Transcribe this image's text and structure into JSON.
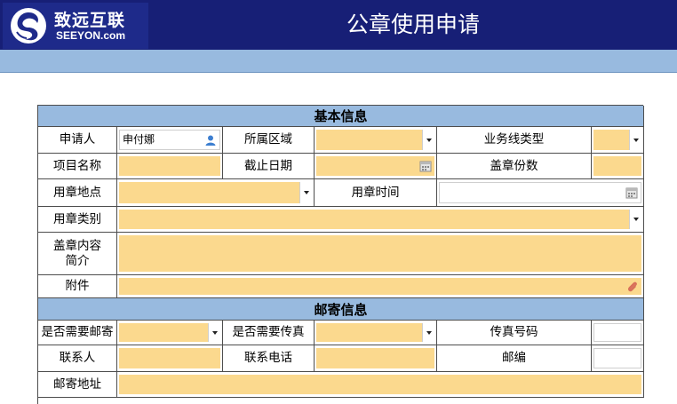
{
  "brand": {
    "name_cn": "致远互联",
    "name_en": "SEEYON.com"
  },
  "page_title": "公章使用申请",
  "sections": {
    "basic": "基本信息",
    "mail": "邮寄信息"
  },
  "labels": {
    "applicant": "申请人",
    "region": "所属区域",
    "business_line_type": "业务线类型",
    "project_name": "项目名称",
    "deadline": "截止日期",
    "seal_copies": "盖章份数",
    "seal_location": "用章地点",
    "seal_time": "用章时间",
    "seal_category": "用章类别",
    "content_line1": "盖章内容",
    "content_line2": "简介",
    "attachment": "附件",
    "need_mail": "是否需要邮寄",
    "need_fax": "是否需要传真",
    "fax_number": "传真号码",
    "contact": "联系人",
    "contact_phone": "联系电话",
    "postcode": "邮编",
    "mail_address": "邮寄地址"
  },
  "values": {
    "applicant": "申付娜"
  },
  "icons": {
    "logo": "seeyon-logo-icon",
    "person": "person-icon",
    "calendar": "calendar-icon",
    "dropdown": "chevron-down-icon",
    "attach": "paperclip-icon"
  },
  "colors": {
    "header_bg": "#171f76",
    "section_bg": "#98badf",
    "field_bg": "#fbd98e"
  }
}
